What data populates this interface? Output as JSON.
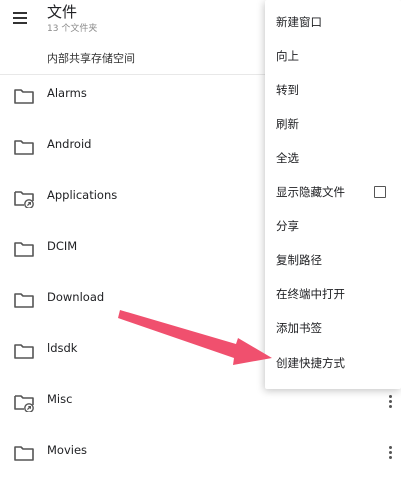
{
  "header": {
    "title": "文件",
    "subtitle": "13 个文件夹",
    "breadcrumb": "内部共享存储空间"
  },
  "folders": [
    {
      "name": "Alarms",
      "icon": "folder-icon"
    },
    {
      "name": "Android",
      "icon": "folder-icon"
    },
    {
      "name": "Applications",
      "icon": "folder-shortcut-icon"
    },
    {
      "name": "DCIM",
      "icon": "folder-icon"
    },
    {
      "name": "Download",
      "icon": "folder-icon"
    },
    {
      "name": "ldsdk",
      "icon": "folder-icon"
    },
    {
      "name": "Misc",
      "icon": "folder-shortcut-icon"
    },
    {
      "name": "Movies",
      "icon": "folder-icon"
    }
  ],
  "menu": {
    "items": [
      "新建窗口",
      "向上",
      "转到",
      "刷新",
      "全选",
      "显示隐藏文件",
      "分享",
      "复制路径",
      "在终端中打开",
      "添加书签",
      "创建快捷方式"
    ],
    "show_hidden_checked": false
  },
  "colors": {
    "arrow": "#f0506e",
    "text": "#202124",
    "secondary_text": "#8a8a8a"
  }
}
